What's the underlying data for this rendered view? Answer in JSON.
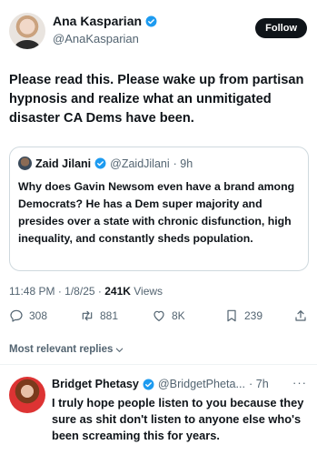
{
  "author": {
    "name": "Ana Kasparian",
    "handle": "@AnaKasparian",
    "follow_label": "Follow"
  },
  "tweet": {
    "text": "Please read this. Please wake up from partisan hypnosis and realize what an unmitigated disaster CA Dems have been."
  },
  "quote": {
    "name": "Zaid Jilani",
    "handle": "@ZaidJilani",
    "time": "· 9h",
    "text": "Why does Gavin Newsom even have a brand among Democrats? He has a Dem super majority and presides over a state with chronic disfunction, high inequality, and constantly sheds population."
  },
  "meta": {
    "time": "11:48 PM",
    "date": "1/8/25",
    "views": "241K",
    "views_label": "Views"
  },
  "actions": {
    "replies": "308",
    "reposts": "881",
    "likes": "8K",
    "bookmarks": "239"
  },
  "sort_label": "Most relevant replies",
  "reply": {
    "name": "Bridget Phetasy",
    "handle": "@BridgetPheta...",
    "time": "· 7h",
    "more": "···",
    "text": "I truly hope people listen to you because they sure as shit don't listen to anyone else who's been screaming this for years."
  },
  "colors": {
    "verified": "#1d9bf0",
    "text": "#0f1419",
    "secondary": "#536471",
    "border": "#cfd9de"
  }
}
